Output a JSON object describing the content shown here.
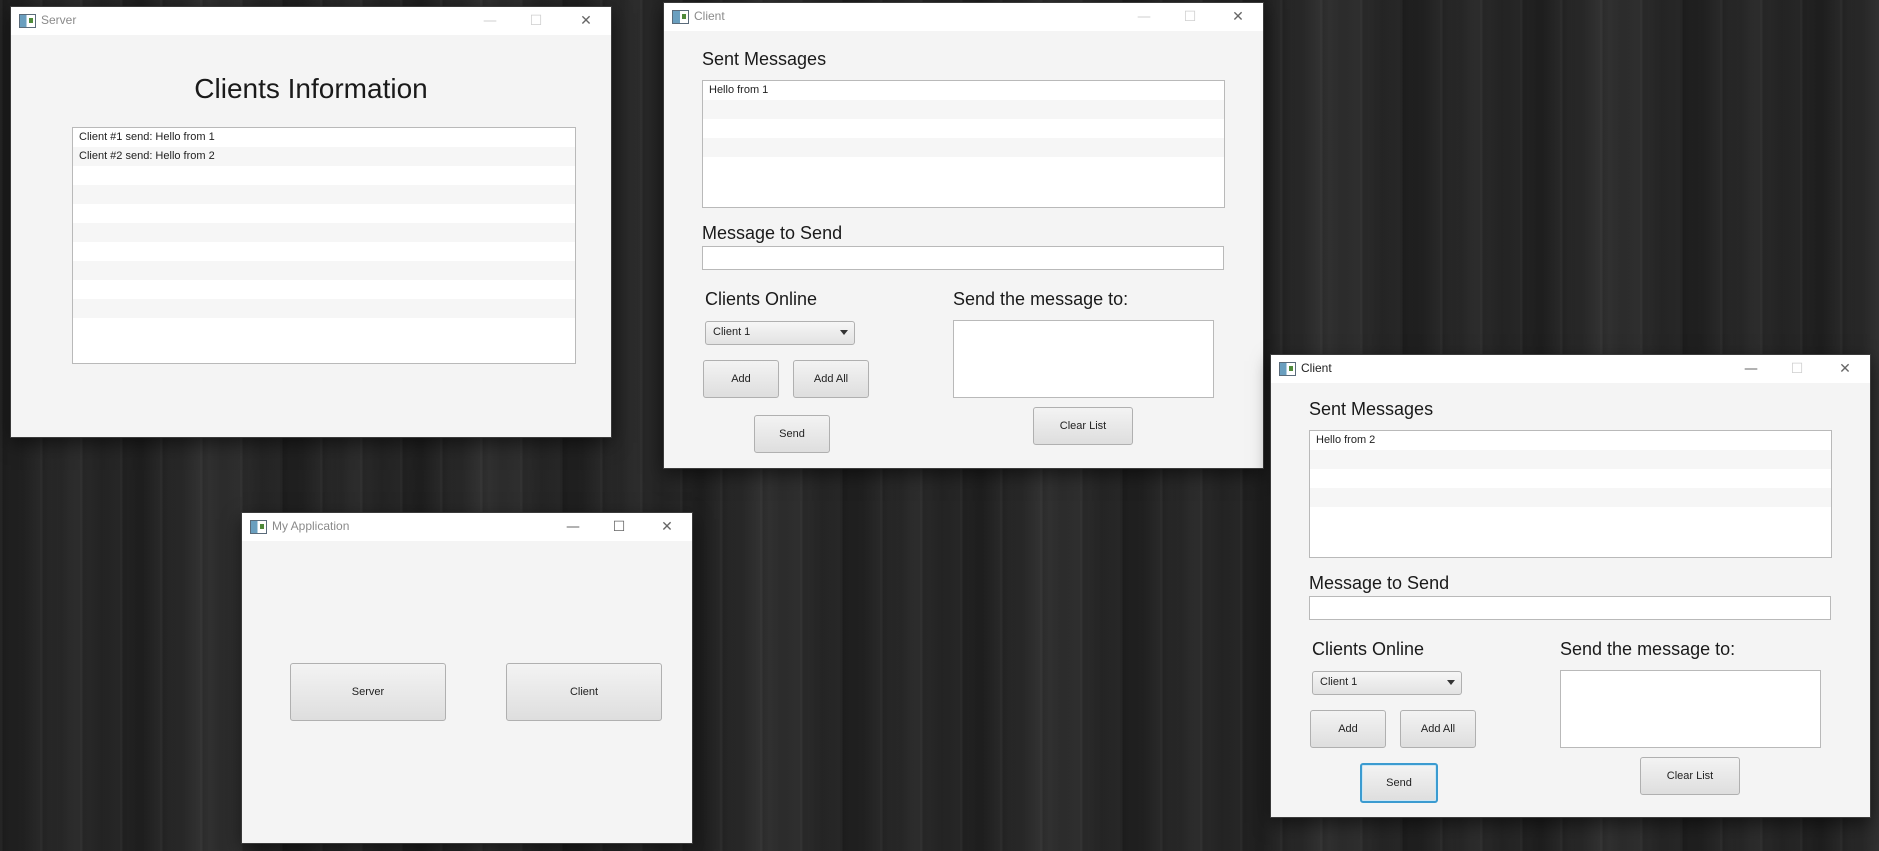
{
  "server_window": {
    "title": "Server",
    "heading": "Clients Information",
    "rows": [
      "Client #1 send: Hello from 1",
      "Client #2 send: Hello from 2",
      "",
      "",
      "",
      "",
      "",
      "",
      "",
      ""
    ],
    "controls": {
      "minimize": "—",
      "maximize": "☐",
      "close": "✕"
    }
  },
  "client_window_1": {
    "title": "Client",
    "sent_messages_label": "Sent Messages",
    "sent_messages": [
      "Hello from 1",
      "",
      "",
      "",
      ""
    ],
    "message_to_send_label": "Message to Send",
    "message_value": "",
    "clients_online_label": "Clients Online",
    "clients_combo_value": "Client 1",
    "add_label": "Add",
    "add_all_label": "Add All",
    "send_label": "Send",
    "send_to_label": "Send the message to:",
    "clear_list_label": "Clear List",
    "controls": {
      "minimize": "—",
      "maximize": "☐",
      "close": "✕"
    }
  },
  "client_window_2": {
    "title": "Client",
    "sent_messages_label": "Sent Messages",
    "sent_messages": [
      "Hello from 2",
      "",
      "",
      "",
      ""
    ],
    "message_to_send_label": "Message to Send",
    "message_value": "",
    "clients_online_label": "Clients Online",
    "clients_combo_value": "Client 1",
    "add_label": "Add",
    "add_all_label": "Add All",
    "send_label": "Send",
    "send_to_label": "Send the message to:",
    "clear_list_label": "Clear List",
    "controls": {
      "minimize": "—",
      "maximize": "☐",
      "close": "✕"
    }
  },
  "app_window": {
    "title": "My Application",
    "server_button": "Server",
    "client_button": "Client",
    "controls": {
      "minimize": "—",
      "maximize": "☐",
      "close": "✕"
    }
  }
}
